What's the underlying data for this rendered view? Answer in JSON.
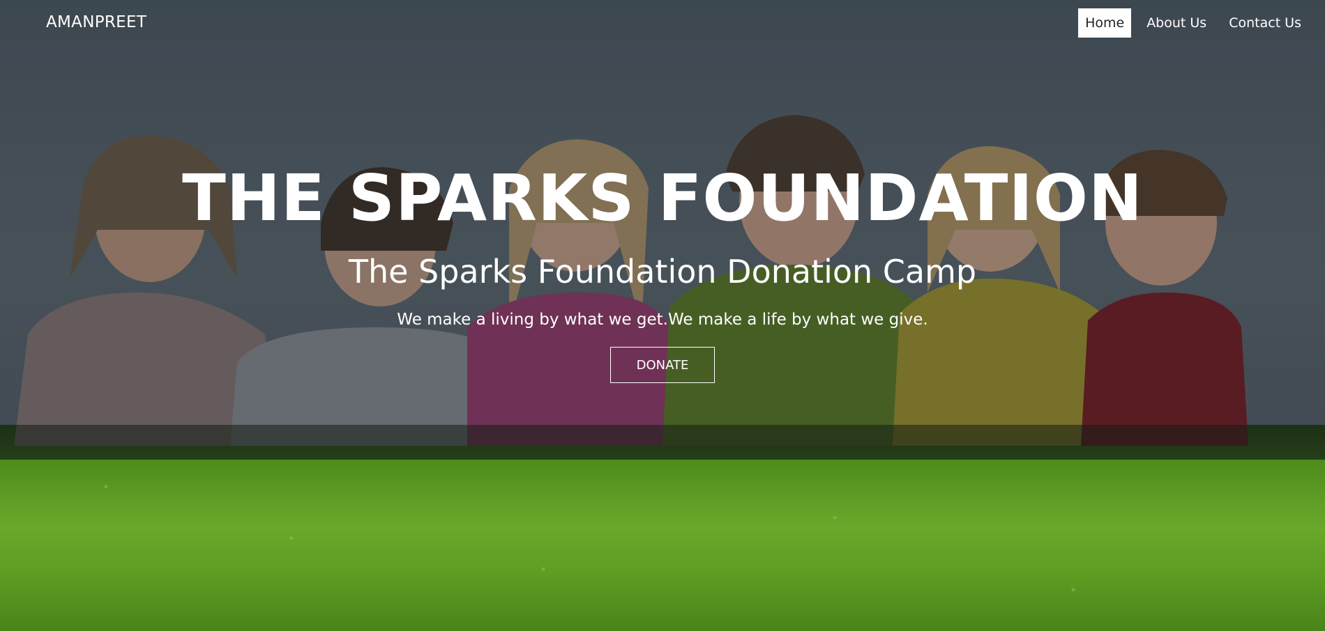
{
  "navbar": {
    "brand": "AMANPREET",
    "items": [
      {
        "label": "Home",
        "active": true
      },
      {
        "label": "About Us",
        "active": false
      },
      {
        "label": "Contact Us",
        "active": false
      }
    ]
  },
  "hero": {
    "title": "THE SPARKS FOUNDATION",
    "subtitle": "The Sparks Foundation Donation Camp",
    "tagline": "We make a living by what we get.We make a life by what we give.",
    "button_label": "DONATE"
  },
  "colors": {
    "text": "#ffffff",
    "active_nav_bg": "#ffffff",
    "active_nav_text": "#222222",
    "grass": "#5c9a22",
    "sky": "#56606a"
  },
  "background": {
    "icon": "children-on-grass-photo"
  }
}
